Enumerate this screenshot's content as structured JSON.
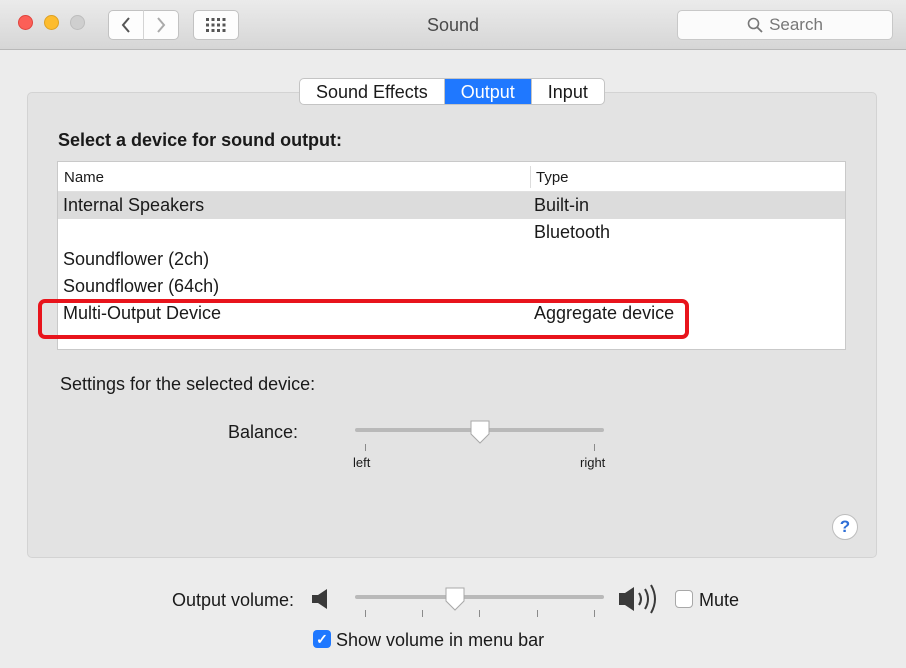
{
  "window": {
    "title": "Sound"
  },
  "toolbar": {
    "search_placeholder": "Search"
  },
  "tabs": [
    {
      "label": "Sound Effects",
      "selected": false
    },
    {
      "label": "Output",
      "selected": true
    },
    {
      "label": "Input",
      "selected": false
    }
  ],
  "output": {
    "heading": "Select a device for sound output:",
    "columns": {
      "name": "Name",
      "type": "Type"
    },
    "devices": [
      {
        "name": "Internal Speakers",
        "type": "Built-in",
        "selected": true
      },
      {
        "name": "",
        "type": "Bluetooth",
        "selected": false
      },
      {
        "name": "Soundflower (2ch)",
        "type": "",
        "selected": false
      },
      {
        "name": "Soundflower (64ch)",
        "type": "",
        "selected": false
      },
      {
        "name": "Multi-Output Device",
        "type": "Aggregate device",
        "selected": false
      }
    ],
    "settings_label": "Settings for the selected device:",
    "balance": {
      "label": "Balance:",
      "left_label": "left",
      "right_label": "right",
      "value": 0.5
    }
  },
  "volume": {
    "label": "Output volume:",
    "value": 0.4,
    "mute_label": "Mute",
    "mute_checked": false,
    "show_in_menu_bar_label": "Show volume in menu bar",
    "show_in_menu_bar_checked": true
  },
  "colors": {
    "accent": "#1f78ff",
    "highlight": "#e8141c",
    "close": "#fc5f57",
    "minimize": "#fdbc2e"
  },
  "icons": {
    "back": "chevron-left-icon",
    "forward": "chevron-right-icon",
    "grid": "grid-icon",
    "search": "search-icon",
    "volume_low": "speaker-low-icon",
    "volume_high": "speaker-high-icon",
    "help": "help-icon"
  }
}
